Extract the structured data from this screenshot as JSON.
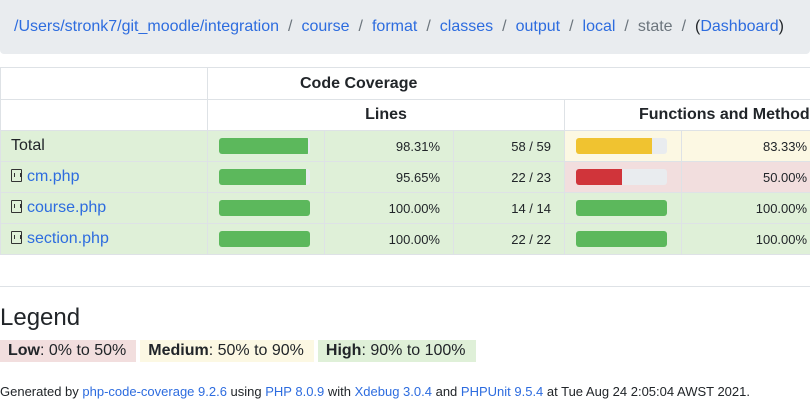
{
  "breadcrumb": {
    "items": [
      {
        "label": "/Users/stronk7/git_moodle/integration",
        "link": true
      },
      {
        "label": "course",
        "link": true
      },
      {
        "label": "format",
        "link": true
      },
      {
        "label": "classes",
        "link": true
      },
      {
        "label": "output",
        "link": true
      },
      {
        "label": "local",
        "link": true
      },
      {
        "label": "state",
        "link": false
      }
    ],
    "dashboard_open": "(",
    "dashboard_label": "Dashboard",
    "dashboard_close": ")",
    "separator": "/"
  },
  "table": {
    "header_group": "Code Coverage",
    "header_lines": "Lines",
    "header_functions": "Functions and Methods",
    "rows": [
      {
        "name": "Total",
        "is_file": false,
        "lines_pct": "98.31%",
        "lines_fill": 0.9831,
        "lines_frac": "58 / 59",
        "func_pct": "83.33%",
        "func_fill": 0.8333,
        "func_level": "medium"
      },
      {
        "name": "cm.php",
        "is_file": true,
        "lines_pct": "95.65%",
        "lines_fill": 0.9565,
        "lines_frac": "22 / 23",
        "func_pct": "50.00%",
        "func_fill": 0.5,
        "func_level": "low"
      },
      {
        "name": "course.php",
        "is_file": true,
        "lines_pct": "100.00%",
        "lines_fill": 1.0,
        "lines_frac": "14 / 14",
        "func_pct": "100.00%",
        "func_fill": 1.0,
        "func_level": "high"
      },
      {
        "name": "section.php",
        "is_file": true,
        "lines_pct": "100.00%",
        "lines_fill": 1.0,
        "lines_frac": "22 / 22",
        "func_pct": "100.00%",
        "func_fill": 1.0,
        "func_level": "high"
      }
    ]
  },
  "colors": {
    "high_bar": "#5cb85c",
    "medium_bar": "#f0c330",
    "low_bar": "#d0343a",
    "high_bg": "#dff0d8",
    "medium_bg": "#fcf8e3",
    "low_bg": "#f2dede",
    "link": "#2d6cdf"
  },
  "legend": {
    "title": "Legend",
    "low_label": "Low",
    "low_range": ": 0% to 50%",
    "medium_label": "Medium",
    "medium_range": ": 50% to 90%",
    "high_label": "High",
    "high_range": ": 90% to 100%"
  },
  "footer": {
    "t1": "Generated by ",
    "a1": "php-code-coverage 9.2.6",
    "t2": " using ",
    "a2": "PHP 8.0.9",
    "t3": " with ",
    "a3": "Xdebug 3.0.4",
    "t4": " and ",
    "a4": "PHPUnit 9.5.4",
    "t5": " at Tue Aug 24 2:05:04 AWST 2021."
  }
}
